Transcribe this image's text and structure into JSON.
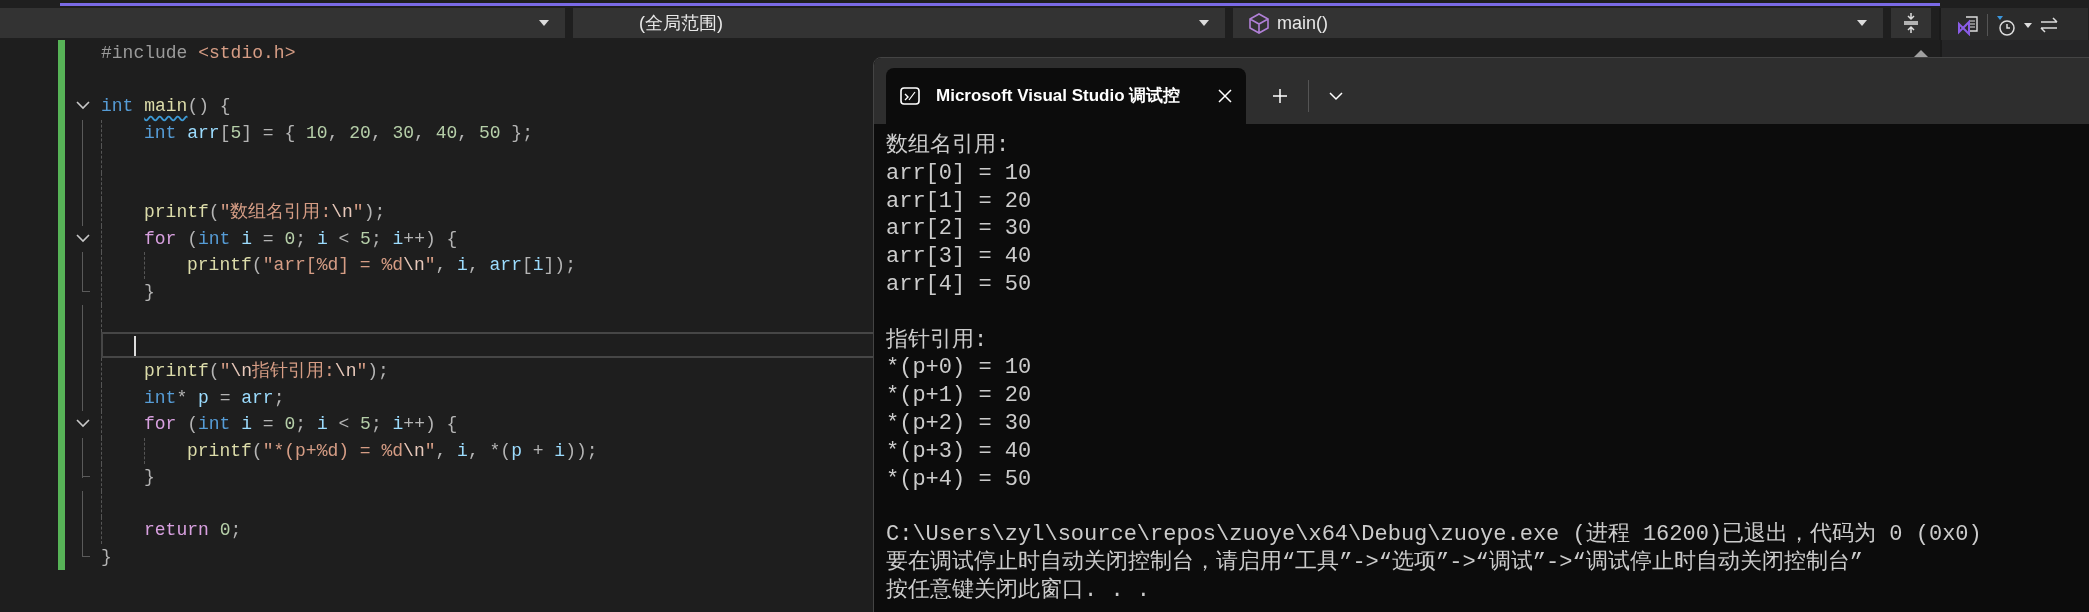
{
  "toolbar": {
    "dropdowns": [
      {
        "kind": "empty"
      },
      {
        "kind": "scope",
        "label": "(全局范围)"
      },
      {
        "kind": "symbol",
        "label": "main()"
      }
    ]
  },
  "editor": {
    "lines": [
      {
        "kind": "code",
        "tokens": [
          {
            "text": "#include ",
            "kind": "pre"
          },
          {
            "text": "<stdio.h>",
            "kind": "str"
          }
        ]
      },
      {
        "kind": "blank"
      },
      {
        "kind": "code",
        "expanded": true,
        "tokens": [
          {
            "text": "int ",
            "kind": "kw"
          },
          {
            "text": "main",
            "kind": "fnw"
          },
          {
            "text": "() {",
            "kind": "op"
          }
        ],
        "children": [
          {
            "kind": "code",
            "tokens": [
              {
                "text": "int ",
                "kind": "kw"
              },
              {
                "text": "arr",
                "kind": "var"
              },
              {
                "text": "[",
                "kind": "op"
              },
              {
                "text": "5",
                "kind": "num"
              },
              {
                "text": "] = { ",
                "kind": "op"
              },
              {
                "text": "10",
                "kind": "num"
              },
              {
                "text": ", ",
                "kind": "op"
              },
              {
                "text": "20",
                "kind": "num"
              },
              {
                "text": ", ",
                "kind": "op"
              },
              {
                "text": "30",
                "kind": "num"
              },
              {
                "text": ", ",
                "kind": "op"
              },
              {
                "text": "40",
                "kind": "num"
              },
              {
                "text": ", ",
                "kind": "op"
              },
              {
                "text": "50",
                "kind": "num"
              },
              {
                "text": " };",
                "kind": "op"
              }
            ]
          },
          {
            "kind": "blank"
          },
          {
            "kind": "blank"
          },
          {
            "kind": "code",
            "tokens": [
              {
                "text": "printf",
                "kind": "fn"
              },
              {
                "text": "(",
                "kind": "op"
              },
              {
                "text": "\"数组名引用:",
                "kind": "str"
              },
              {
                "text": "\\n",
                "kind": "esc"
              },
              {
                "text": "\"",
                "kind": "str"
              },
              {
                "text": ");",
                "kind": "op"
              }
            ]
          },
          {
            "kind": "code",
            "expanded": true,
            "tokens": [
              {
                "text": "for",
                "kind": "ctrl"
              },
              {
                "text": " (",
                "kind": "op"
              },
              {
                "text": "int ",
                "kind": "kw"
              },
              {
                "text": "i",
                "kind": "var"
              },
              {
                "text": " = ",
                "kind": "op"
              },
              {
                "text": "0",
                "kind": "num"
              },
              {
                "text": "; ",
                "kind": "op"
              },
              {
                "text": "i",
                "kind": "var"
              },
              {
                "text": " < ",
                "kind": "op"
              },
              {
                "text": "5",
                "kind": "num"
              },
              {
                "text": "; ",
                "kind": "op"
              },
              {
                "text": "i",
                "kind": "var"
              },
              {
                "text": "++) {",
                "kind": "op"
              }
            ],
            "children": [
              {
                "kind": "code",
                "tokens": [
                  {
                    "text": "printf",
                    "kind": "fn"
                  },
                  {
                    "text": "(",
                    "kind": "op"
                  },
                  {
                    "text": "\"arr[",
                    "kind": "str"
                  },
                  {
                    "text": "%d",
                    "kind": "fmt"
                  },
                  {
                    "text": "] = ",
                    "kind": "str"
                  },
                  {
                    "text": "%d",
                    "kind": "fmt"
                  },
                  {
                    "text": "\\n",
                    "kind": "esc"
                  },
                  {
                    "text": "\"",
                    "kind": "str"
                  },
                  {
                    "text": ", ",
                    "kind": "op"
                  },
                  {
                    "text": "i",
                    "kind": "var"
                  },
                  {
                    "text": ", ",
                    "kind": "op"
                  },
                  {
                    "text": "arr",
                    "kind": "var"
                  },
                  {
                    "text": "[",
                    "kind": "op"
                  },
                  {
                    "text": "i",
                    "kind": "var"
                  },
                  {
                    "text": "]);",
                    "kind": "op"
                  }
                ]
              }
            ],
            "closing": [
              {
                "text": "}",
                "kind": "op"
              }
            ]
          },
          {
            "kind": "blank"
          },
          {
            "kind": "blank",
            "current": true
          },
          {
            "kind": "code",
            "tokens": [
              {
                "text": "printf",
                "kind": "fn"
              },
              {
                "text": "(",
                "kind": "op"
              },
              {
                "text": "\"",
                "kind": "str"
              },
              {
                "text": "\\n",
                "kind": "esc"
              },
              {
                "text": "指针引用:",
                "kind": "str"
              },
              {
                "text": "\\n",
                "kind": "esc"
              },
              {
                "text": "\"",
                "kind": "str"
              },
              {
                "text": ");",
                "kind": "op"
              }
            ]
          },
          {
            "kind": "code",
            "tokens": [
              {
                "text": "int",
                "kind": "kw"
              },
              {
                "text": "* ",
                "kind": "op"
              },
              {
                "text": "p",
                "kind": "var"
              },
              {
                "text": " = ",
                "kind": "op"
              },
              {
                "text": "arr",
                "kind": "var"
              },
              {
                "text": ";",
                "kind": "op"
              }
            ]
          },
          {
            "kind": "code",
            "expanded": true,
            "tokens": [
              {
                "text": "for",
                "kind": "ctrl"
              },
              {
                "text": " (",
                "kind": "op"
              },
              {
                "text": "int ",
                "kind": "kw"
              },
              {
                "text": "i",
                "kind": "var"
              },
              {
                "text": " = ",
                "kind": "op"
              },
              {
                "text": "0",
                "kind": "num"
              },
              {
                "text": "; ",
                "kind": "op"
              },
              {
                "text": "i",
                "kind": "var"
              },
              {
                "text": " < ",
                "kind": "op"
              },
              {
                "text": "5",
                "kind": "num"
              },
              {
                "text": "; ",
                "kind": "op"
              },
              {
                "text": "i",
                "kind": "var"
              },
              {
                "text": "++) {",
                "kind": "op"
              }
            ],
            "children": [
              {
                "kind": "code",
                "tokens": [
                  {
                    "text": "printf",
                    "kind": "fn"
                  },
                  {
                    "text": "(",
                    "kind": "op"
                  },
                  {
                    "text": "\"*(p+",
                    "kind": "str"
                  },
                  {
                    "text": "%d",
                    "kind": "fmt"
                  },
                  {
                    "text": ") = ",
                    "kind": "str"
                  },
                  {
                    "text": "%d",
                    "kind": "fmt"
                  },
                  {
                    "text": "\\n",
                    "kind": "esc"
                  },
                  {
                    "text": "\"",
                    "kind": "str"
                  },
                  {
                    "text": ", ",
                    "kind": "op"
                  },
                  {
                    "text": "i",
                    "kind": "var"
                  },
                  {
                    "text": ", *(",
                    "kind": "op"
                  },
                  {
                    "text": "p",
                    "kind": "var"
                  },
                  {
                    "text": " + ",
                    "kind": "op"
                  },
                  {
                    "text": "i",
                    "kind": "var"
                  },
                  {
                    "text": "));",
                    "kind": "op"
                  }
                ]
              }
            ],
            "closing": [
              {
                "text": "}",
                "kind": "op"
              }
            ]
          },
          {
            "kind": "blank"
          },
          {
            "kind": "code",
            "tokens": [
              {
                "text": "return ",
                "kind": "ctrl"
              },
              {
                "text": "0",
                "kind": "num"
              },
              {
                "text": ";",
                "kind": "op"
              }
            ]
          }
        ],
        "closing": [
          {
            "text": "}",
            "kind": "op"
          }
        ]
      }
    ]
  },
  "console": {
    "tab_title": "Microsoft Visual Studio 调试控",
    "blocks": [
      [
        "数组名引用:",
        "arr[0] = 10",
        "arr[1] = 20",
        "arr[2] = 30",
        "arr[3] = 40",
        "arr[4] = 50"
      ],
      [
        "指针引用:",
        "*(p+0) = 10",
        "*(p+1) = 20",
        "*(p+2) = 30",
        "*(p+3) = 40",
        "*(p+4) = 50"
      ],
      [
        "C:\\Users\\zyl\\source\\repos\\zuoye\\x64\\Debug\\zuoye.exe (进程 16200)已退出，代码为 0 (0x0)",
        "要在调试停止时自动关闭控制台，请启用“工具”->“选项”->“调试”->“调试停止时自动关闭控制台”",
        "按任意键关闭此窗口. . ."
      ]
    ]
  }
}
